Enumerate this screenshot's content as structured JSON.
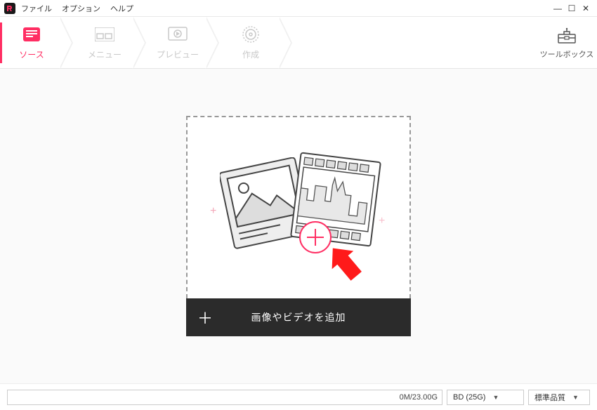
{
  "menu": {
    "file": "ファイル",
    "option": "オプション",
    "help": "ヘルプ"
  },
  "window": {
    "min": "—",
    "max": "☐",
    "close": "✕"
  },
  "steps": {
    "source": {
      "label": "ソース"
    },
    "menu": {
      "label": "メニュー"
    },
    "preview": {
      "label": "プレビュー"
    },
    "create": {
      "label": "作成"
    }
  },
  "toolbox": {
    "label": "ツールボックス"
  },
  "drop": {
    "add_label": "画像やビデオを追加",
    "plus": "＋"
  },
  "status": {
    "capacity": "0M/23.00G",
    "disc_type": "BD (25G)",
    "quality": "標準品質"
  }
}
